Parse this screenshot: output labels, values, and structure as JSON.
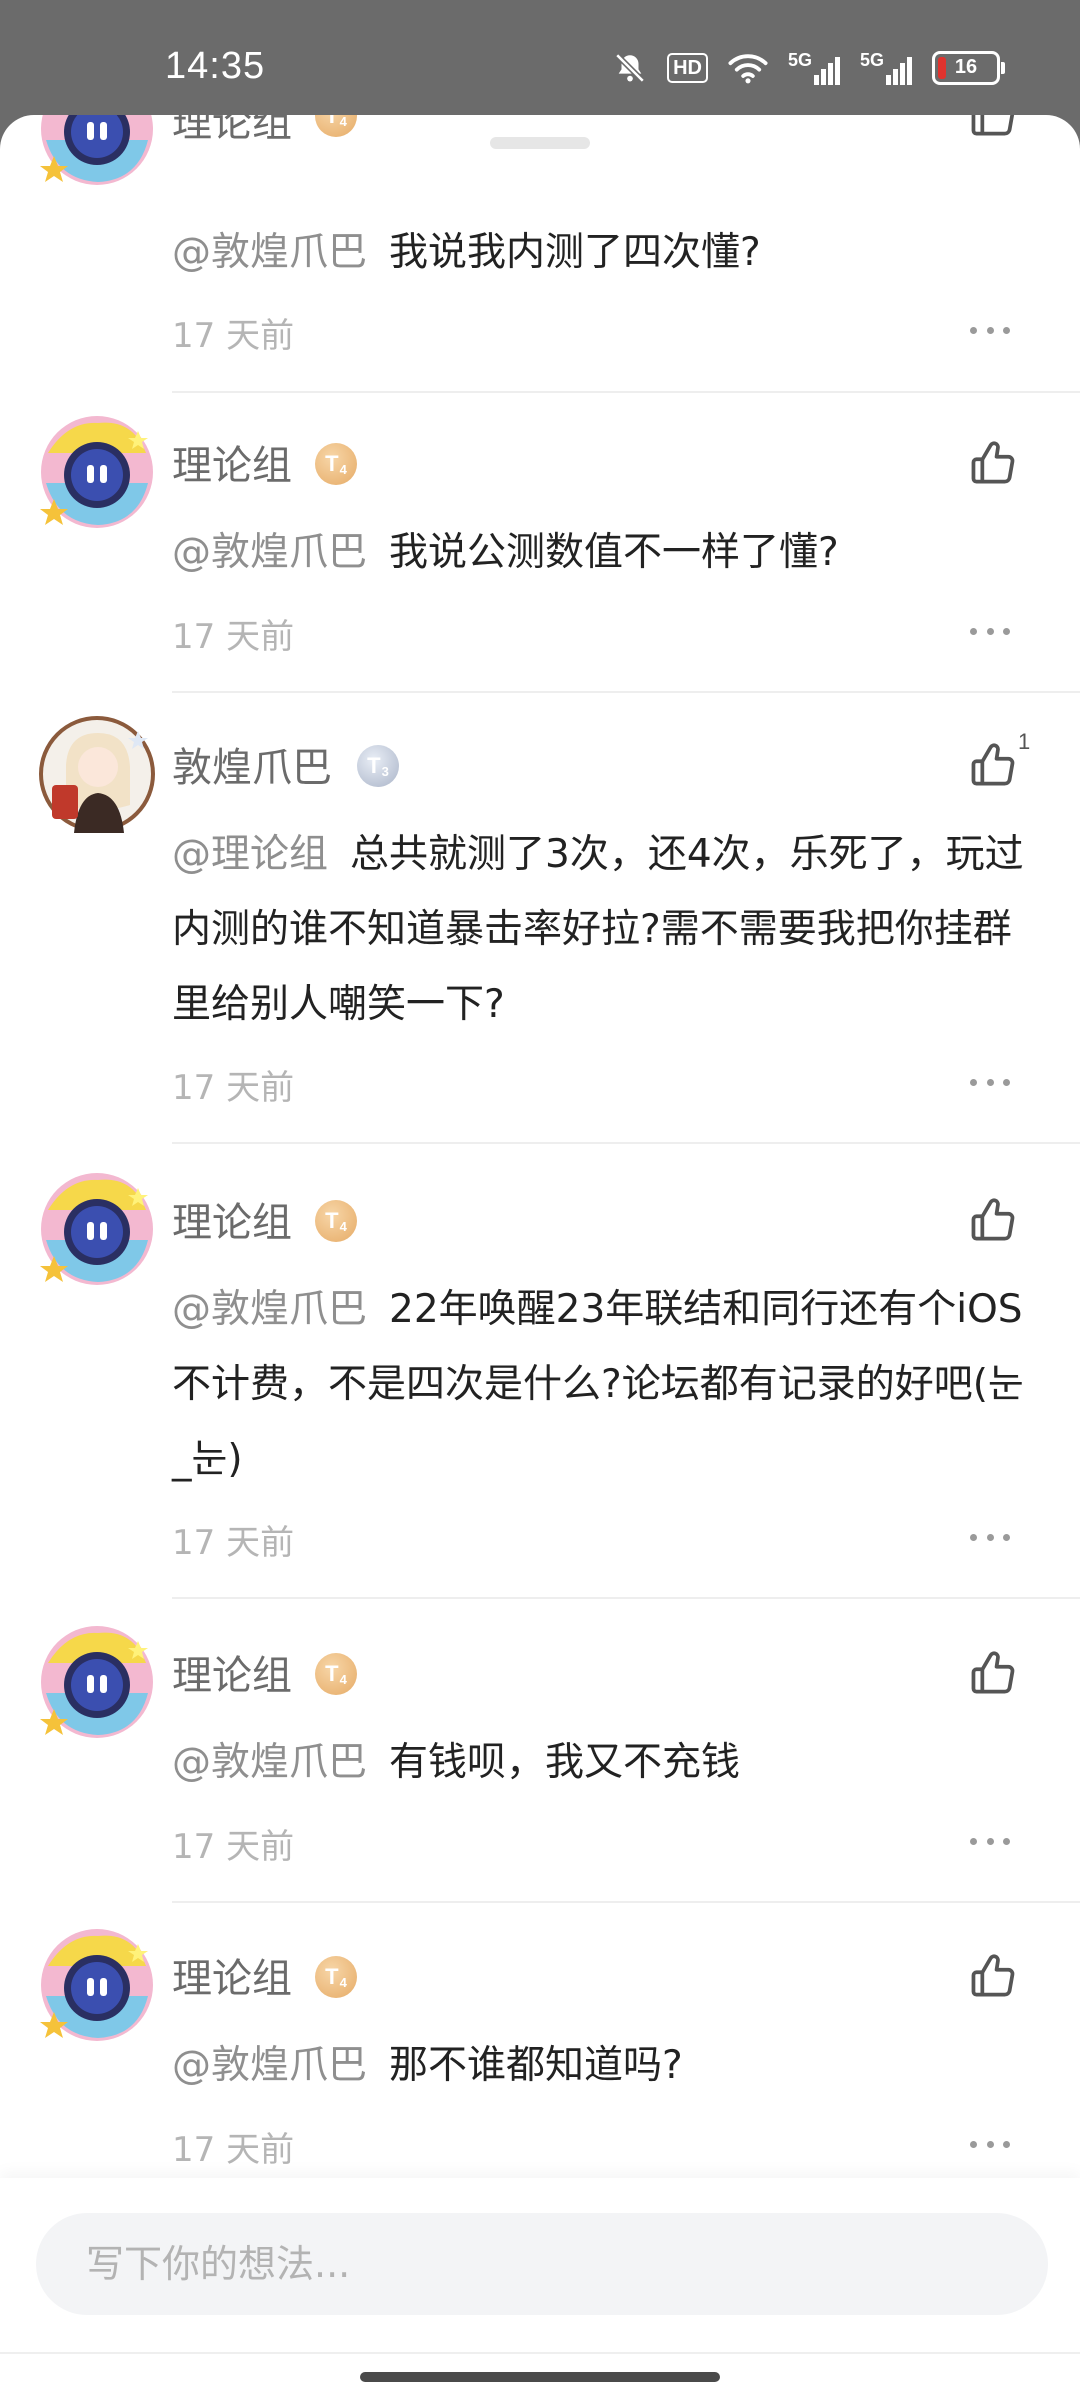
{
  "status_bar": {
    "time": "14:35",
    "icons": [
      "bell-off-icon",
      "hd-icon",
      "wifi-icon",
      "signal-5g-icon",
      "signal-5g-icon"
    ],
    "hd_label": "HD",
    "net1": "5G",
    "net2": "5G",
    "battery": "16"
  },
  "comments": [
    {
      "name": "理论组",
      "badge": "T",
      "badge_level": "4",
      "mention": "@敦煌爪巴",
      "text": "我说我内测了四次懂?",
      "time": "17 天前"
    },
    {
      "name": "理论组",
      "badge": "T",
      "badge_level": "4",
      "mention": "@敦煌爪巴",
      "text": "我说公测数值不一样了懂?",
      "time": "17 天前"
    },
    {
      "name": "敦煌爪巴",
      "badge": "T",
      "badge_level": "3",
      "like_count": "1",
      "mention": "@理论组",
      "text": "总共就测了3次，还4次，乐死了，玩过内测的谁不知道暴击率好拉?需不需要我把你挂群里给别人嘲笑一下?",
      "time": "17 天前"
    },
    {
      "name": "理论组",
      "badge": "T",
      "badge_level": "4",
      "mention": "@敦煌爪巴",
      "text": "22年唤醒23年联结和同行还有个iOS不计费，不是四次是什么?论坛都有记录的好吧(눈_눈)",
      "time": "17 天前"
    },
    {
      "name": "理论组",
      "badge": "T",
      "badge_level": "4",
      "mention": "@敦煌爪巴",
      "text": "有钱呗，我又不充钱",
      "time": "17 天前"
    },
    {
      "name": "理论组",
      "badge": "T",
      "badge_level": "4",
      "mention": "@敦煌爪巴",
      "text": "那不谁都知道吗?",
      "time": "17 天前"
    }
  ],
  "composer": {
    "placeholder": "写下你的想法..."
  },
  "colors": {
    "background_dim": "#6d6d6d",
    "sheet": "#ffffff",
    "text_primary": "#222222",
    "text_secondary": "#8f8f8f",
    "badge_gold": "#e6ab66",
    "badge_silver": "#aab4c8"
  }
}
